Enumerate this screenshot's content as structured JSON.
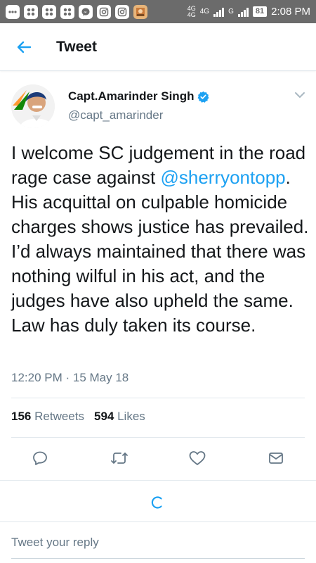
{
  "status_bar": {
    "network_top": "4G",
    "network_bottom": "4G",
    "network_label": "4G",
    "network_g": "G",
    "battery": "81",
    "time": "2:08 PM"
  },
  "header": {
    "title": "Tweet"
  },
  "tweet": {
    "author_name": "Capt.Amarinder Singh",
    "author_handle": "@capt_amarinder",
    "text_part1": "I welcome SC judgement in the road rage case against ",
    "mention": "@sherryontopp",
    "text_part2": ". His acquittal on culpable homicide charges shows justice has prevailed. I’d always maintained that there was nothing wilful in his act, and the judges have also upheld the same. Law has duly taken its course.",
    "timestamp": "12:20 PM · 15 May 18",
    "retweets_count": "156",
    "retweets_label": "Retweets",
    "likes_count": "594",
    "likes_label": "Likes"
  },
  "reply": {
    "placeholder": "Tweet your reply"
  },
  "colors": {
    "accent": "#1da1f2",
    "secondary_text": "#657786",
    "status_bar": "#6b6b6b"
  },
  "icons": {
    "back": "arrow-left-icon",
    "verified": "verified-badge-icon",
    "caret": "chevron-down-icon",
    "reply": "reply-icon",
    "retweet": "retweet-icon",
    "like": "heart-icon",
    "share": "share-icon",
    "loading": "loading-spinner-icon"
  }
}
